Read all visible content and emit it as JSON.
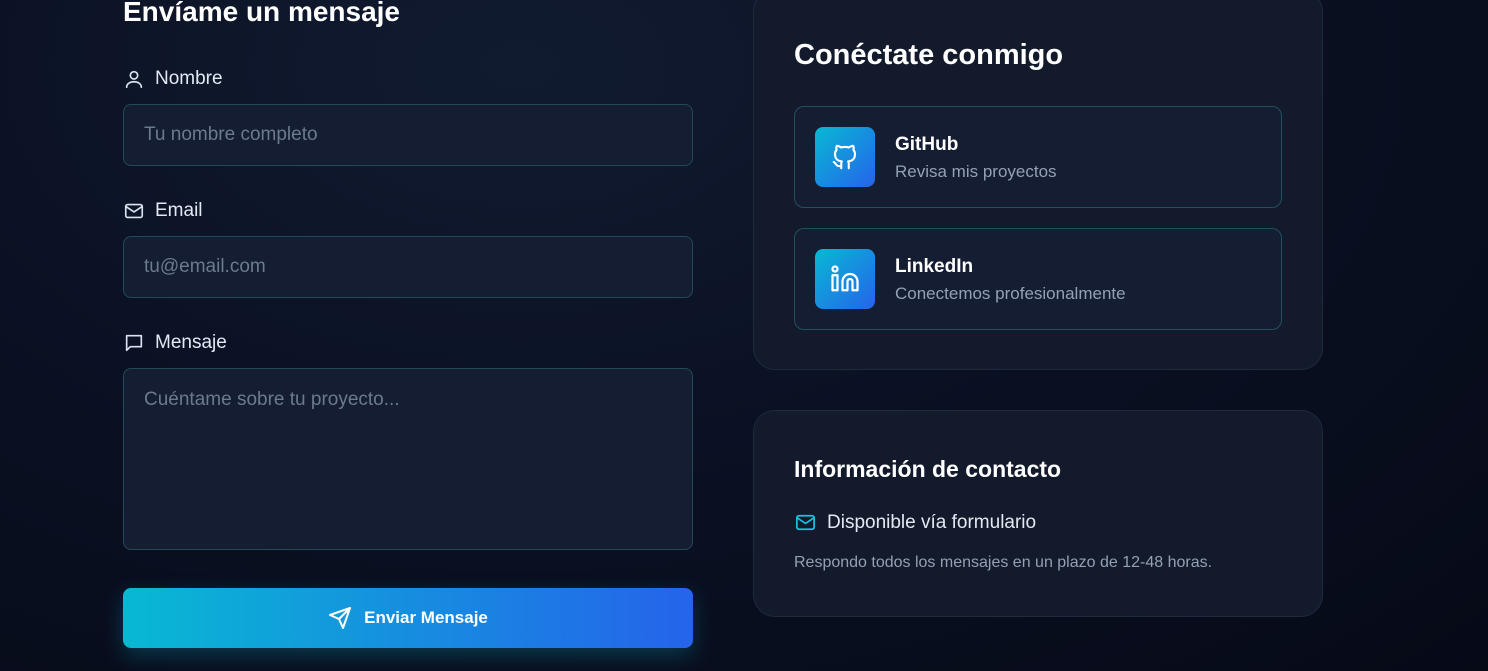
{
  "form": {
    "title": "Envíame un mensaje",
    "name": {
      "label": "Nombre",
      "placeholder": "Tu nombre completo",
      "value": ""
    },
    "email": {
      "label": "Email",
      "placeholder": "tu@email.com",
      "value": ""
    },
    "message": {
      "label": "Mensaje",
      "placeholder": "Cuéntame sobre tu proyecto...",
      "value": ""
    },
    "submit_label": "Enviar Mensaje"
  },
  "connect": {
    "title": "Conéctate conmigo",
    "items": [
      {
        "name": "GitHub",
        "description": "Revisa mis proyectos",
        "icon": "github-icon"
      },
      {
        "name": "LinkedIn",
        "description": "Conectemos profesionalmente",
        "icon": "linkedin-icon"
      }
    ]
  },
  "contact_info": {
    "title": "Información de contacto",
    "availability": "Disponible vía formulario",
    "note": "Respondo todos los mensajes en un plazo de 12-48 horas.",
    "icon": "mail-icon"
  },
  "colors": {
    "accent_start": "#08b9d3",
    "accent_end": "#2563eb",
    "background": "#0b1124",
    "card": "#121a2c",
    "input": "#141d31",
    "border": "#22495a"
  }
}
